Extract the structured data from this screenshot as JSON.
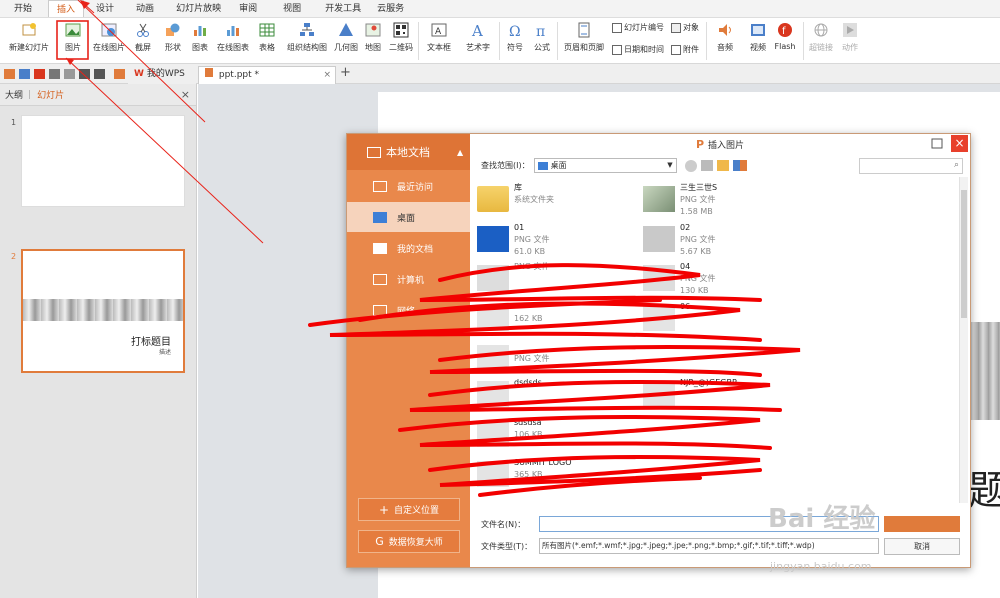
{
  "menu": {
    "tabs": [
      "开始",
      "插入",
      "设计",
      "动画",
      "幻灯片放映",
      "审阅",
      "视图",
      "开发工具",
      "云服务"
    ],
    "active_index": 1
  },
  "ribbon": {
    "new_slide": "新建幻灯片",
    "picture": "图片",
    "online_picture": "在线图片",
    "screenshot": "截屏",
    "shape": "形状",
    "chart": "图表",
    "online_chart": "在线图表",
    "table": "表格",
    "org_chart": "组织结构图",
    "geometry": "几何图",
    "map": "地图",
    "qrcode": "二维码",
    "textbox": "文本框",
    "wordart": "艺术字",
    "symbol": "符号",
    "formula": "公式",
    "header_footer": "页眉和页脚",
    "slide_number": "幻灯片编号",
    "date_time": "日期和时间",
    "object": "对象",
    "attachment": "附件",
    "audio": "音频",
    "video": "视频",
    "flash": "Flash",
    "hyperlink": "超链接",
    "action": "动作"
  },
  "doctabs": {
    "my_wps": "我的WPS",
    "file": "ppt.ppt *",
    "plus": "+"
  },
  "leftpanel": {
    "outline": "大纲",
    "slides": "幻灯片",
    "close": "×",
    "slide1_num": "1",
    "slide2_num": "2",
    "slide2_title": "打标题目",
    "slide2_sub": "描述"
  },
  "canvas": {
    "title_char": "题"
  },
  "dialog": {
    "title": "插入图片",
    "close": "×",
    "side_title": "本地文档",
    "side_items": [
      "最近访问",
      "桌面",
      "我的文档",
      "计算机",
      "网络"
    ],
    "side_selected": 1,
    "custom_location": "自定义位置",
    "data_recovery": "数据恢复大师",
    "look_in_label": "查找范围(I)：",
    "look_in_value": "桌面",
    "filename_label": "文件名(N)：",
    "filename_value": "",
    "filetype_label": "文件类型(T)：",
    "filetype_value": "所有图片(*.emf;*.wmf;*.jpg;*.jpeg;*.jpe;*.png;*.bmp;*.gif;*.tif;*.tiff;*.wdp)",
    "cancel": "取消",
    "files": [
      {
        "name": "库",
        "type": "系统文件夹",
        "size": ""
      },
      {
        "name": "三生三世S",
        "type": "PNG 文件",
        "size": "1.58 MB"
      },
      {
        "name": "01",
        "type": "PNG 文件",
        "size": "61.0 KB"
      },
      {
        "name": "02",
        "type": "PNG 文件",
        "size": "5.67 KB"
      },
      {
        "name": "",
        "type": "PNG 文件",
        "size": ""
      },
      {
        "name": "04",
        "type": "PNG 文件",
        "size": "130 KB"
      },
      {
        "name": "",
        "type": "",
        "size": "162 KB"
      },
      {
        "name": "06",
        "type": "",
        "size": ""
      },
      {
        "name": "",
        "type": "PNG 文件",
        "size": ""
      },
      {
        "name": "dsdsds",
        "type": "",
        "size": ""
      },
      {
        "name": "NJR_@)GEGBP",
        "type": "",
        "size": ""
      },
      {
        "name": "sdsdsa",
        "type": "",
        "size": "106 KB"
      },
      {
        "name": "SUMMIT LOGO",
        "type": "",
        "size": "365 KB"
      }
    ]
  },
  "watermark": {
    "brand": "Bai 经验",
    "url": "jingyan.baidu.com"
  },
  "colors": {
    "accent": "#e07b3b",
    "sidebar": "#e9884b",
    "annotation": "#e8231a"
  }
}
